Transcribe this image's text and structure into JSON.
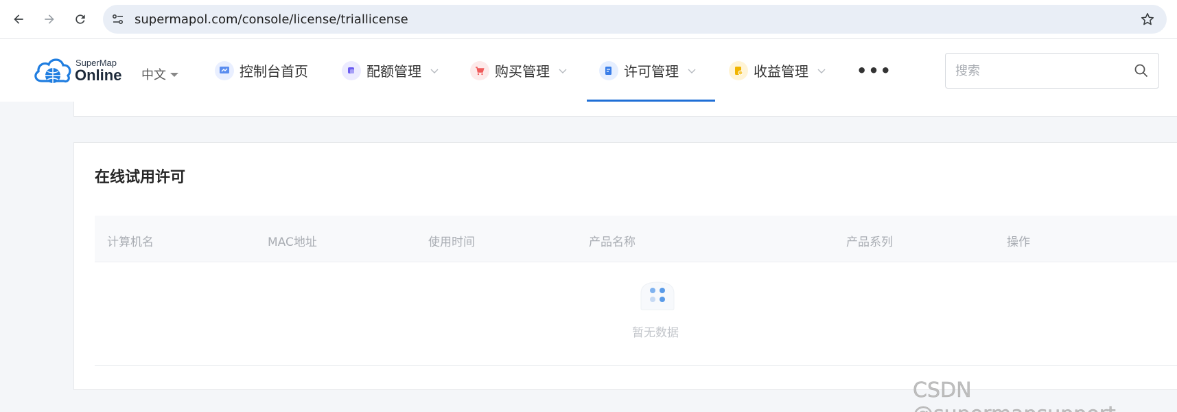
{
  "browser": {
    "url": "supermapol.com/console/license/triallicense"
  },
  "header": {
    "logo_super": "SuperMap",
    "logo_online": "Online",
    "language": "中文",
    "menu": [
      {
        "label": "控制台首页",
        "icon": "console-home-icon",
        "color": "#5b8def",
        "has_dropdown": false
      },
      {
        "label": "配额管理",
        "icon": "quota-icon",
        "color": "#6b5cf0",
        "has_dropdown": true
      },
      {
        "label": "购买管理",
        "icon": "cart-icon",
        "color": "#ef5b5b",
        "has_dropdown": true
      },
      {
        "label": "许可管理",
        "icon": "license-icon",
        "color": "#3a7ee8",
        "has_dropdown": true,
        "active": true
      },
      {
        "label": "收益管理",
        "icon": "revenue-icon",
        "color": "#f0b400",
        "has_dropdown": true
      }
    ],
    "more_label": "•••",
    "search_placeholder": "搜索"
  },
  "main": {
    "title": "在线试用许可",
    "columns": [
      "计算机名",
      "MAC地址",
      "使用时间",
      "产品名称",
      "产品系列",
      "操作"
    ],
    "rows": [],
    "empty_text": "暂无数据"
  },
  "watermark": "CSDN @supermapsupport",
  "colors": {
    "accent": "#1f6fd6",
    "page_bg": "#f4f6f9"
  }
}
